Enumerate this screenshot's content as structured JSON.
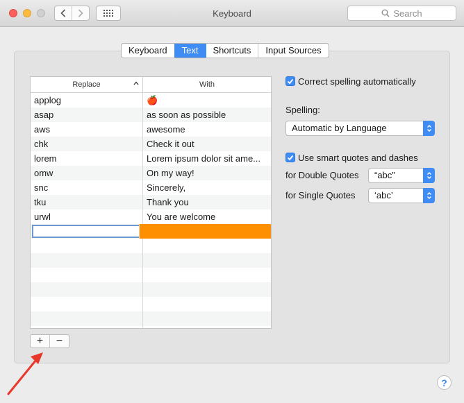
{
  "window": {
    "title": "Keyboard"
  },
  "search": {
    "placeholder": "Search"
  },
  "tabs": [
    {
      "label": "Keyboard",
      "active": false
    },
    {
      "label": "Text",
      "active": true
    },
    {
      "label": "Shortcuts",
      "active": false
    },
    {
      "label": "Input Sources",
      "active": false
    }
  ],
  "table": {
    "columns": {
      "replace": "Replace",
      "with": "With"
    },
    "rows": [
      {
        "replace": "applog",
        "with": "🍎"
      },
      {
        "replace": "asap",
        "with": "as soon as possible"
      },
      {
        "replace": "aws",
        "with": "awesome"
      },
      {
        "replace": "chk",
        "with": "Check it out"
      },
      {
        "replace": "lorem",
        "with": "Lorem ipsum dolor sit ame..."
      },
      {
        "replace": "omw",
        "with": "On my way!"
      },
      {
        "replace": "snc",
        "with": "Sincerely,"
      },
      {
        "replace": "tku",
        "with": "Thank you"
      },
      {
        "replace": "urwl",
        "with": "You are welcome"
      }
    ],
    "editing_row": {
      "replace": "",
      "with": ""
    }
  },
  "buttons": {
    "add": "+",
    "remove": "−"
  },
  "options": {
    "correct_spelling": {
      "label": "Correct spelling automatically",
      "checked": true
    },
    "spelling_label": "Spelling:",
    "spelling_value": "Automatic by Language",
    "smart_quotes": {
      "label": "Use smart quotes and dashes",
      "checked": true
    },
    "double_quotes_label": "for Double Quotes",
    "double_quotes_value": "“abc”",
    "single_quotes_label": "for Single Quotes",
    "single_quotes_value": "‘abc’"
  },
  "help": {
    "label": "?"
  },
  "colors": {
    "accent": "#3f8cf5",
    "selection": "#fd8f00",
    "annotation_arrow": "#e8372b"
  }
}
